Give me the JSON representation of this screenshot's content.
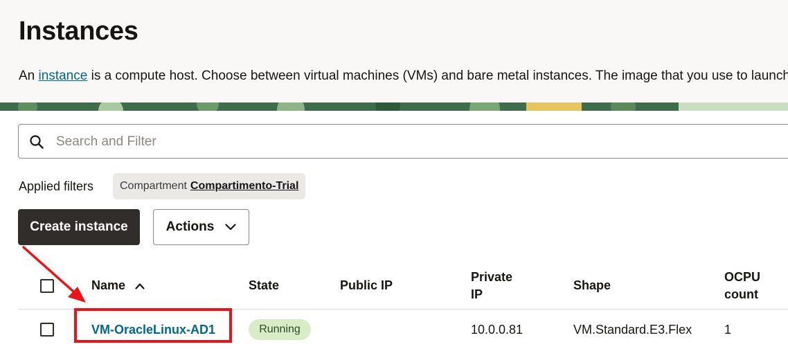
{
  "page": {
    "title": "Instances",
    "intro_prefix": "An ",
    "intro_link": "instance",
    "intro_suffix": " is a compute host. Choose between virtual machines (VMs) and bare metal instances. The image that you use to launch"
  },
  "search": {
    "placeholder": "Search and Filter",
    "icon": "search-icon"
  },
  "filters": {
    "label": "Applied filters",
    "chips": [
      {
        "key": "Compartment",
        "value": "Compartimento-Trial"
      }
    ]
  },
  "toolbar": {
    "create_label": "Create instance",
    "actions_label": "Actions"
  },
  "table": {
    "columns": [
      "Name",
      "State",
      "Public IP",
      "Private IP",
      "Shape",
      "OCPU count"
    ],
    "column_lines": {
      "private_ip": [
        "Private",
        "IP"
      ],
      "ocpu": [
        "OCPU",
        "count"
      ]
    },
    "sort": {
      "column": "Name",
      "direction": "ascending"
    },
    "rows": [
      {
        "name": "VM-OracleLinux-AD1",
        "state": "Running",
        "public_ip": "",
        "private_ip": "10.0.0.81",
        "shape": "VM.Standard.E3.Flex",
        "ocpu": "1"
      }
    ]
  },
  "colors": {
    "link": "#00688c",
    "primary_button": "#312d2a",
    "running_badge": "#d7ecc7",
    "annotation": "#e8141a"
  }
}
